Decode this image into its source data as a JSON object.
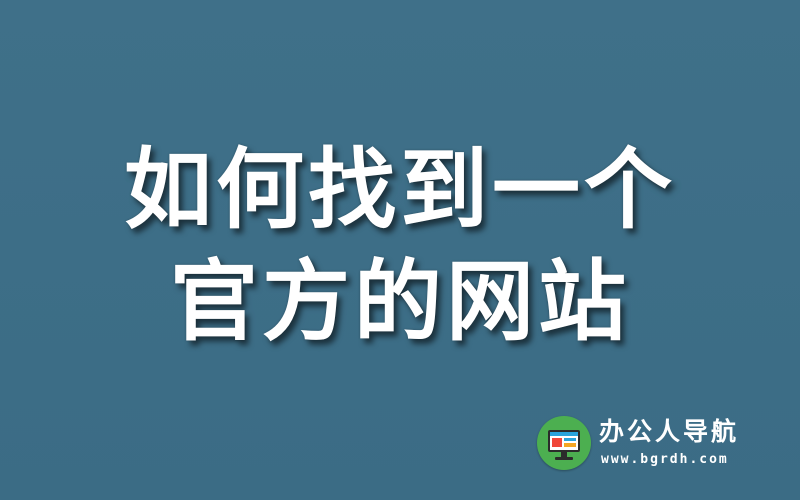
{
  "banner": {
    "background_color": "#3d6e87",
    "headline_line1": "如何找到一个",
    "headline_line2": "官方的网站"
  },
  "logo": {
    "icon": "computer-monitor-icon",
    "badge_color": "#4caf50",
    "name": "办公人导航",
    "url": "www.bgrdh.com"
  }
}
